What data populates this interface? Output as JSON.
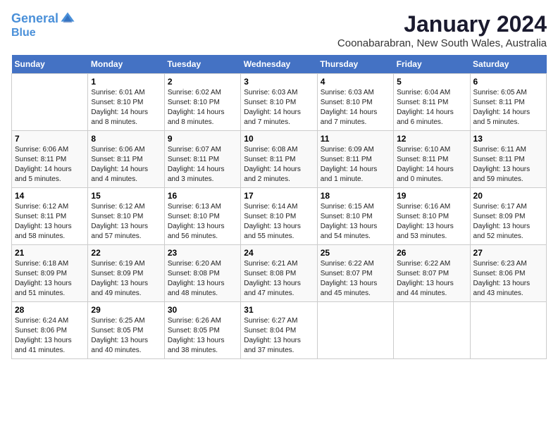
{
  "logo": {
    "line1": "General",
    "line2": "Blue"
  },
  "title": "January 2024",
  "subtitle": "Coonabarabran, New South Wales, Australia",
  "days_of_week": [
    "Sunday",
    "Monday",
    "Tuesday",
    "Wednesday",
    "Thursday",
    "Friday",
    "Saturday"
  ],
  "weeks": [
    [
      {
        "num": "",
        "sunrise": "",
        "sunset": "",
        "daylight": ""
      },
      {
        "num": "1",
        "sunrise": "Sunrise: 6:01 AM",
        "sunset": "Sunset: 8:10 PM",
        "daylight": "Daylight: 14 hours and 8 minutes."
      },
      {
        "num": "2",
        "sunrise": "Sunrise: 6:02 AM",
        "sunset": "Sunset: 8:10 PM",
        "daylight": "Daylight: 14 hours and 8 minutes."
      },
      {
        "num": "3",
        "sunrise": "Sunrise: 6:03 AM",
        "sunset": "Sunset: 8:10 PM",
        "daylight": "Daylight: 14 hours and 7 minutes."
      },
      {
        "num": "4",
        "sunrise": "Sunrise: 6:03 AM",
        "sunset": "Sunset: 8:10 PM",
        "daylight": "Daylight: 14 hours and 7 minutes."
      },
      {
        "num": "5",
        "sunrise": "Sunrise: 6:04 AM",
        "sunset": "Sunset: 8:11 PM",
        "daylight": "Daylight: 14 hours and 6 minutes."
      },
      {
        "num": "6",
        "sunrise": "Sunrise: 6:05 AM",
        "sunset": "Sunset: 8:11 PM",
        "daylight": "Daylight: 14 hours and 5 minutes."
      }
    ],
    [
      {
        "num": "7",
        "sunrise": "Sunrise: 6:06 AM",
        "sunset": "Sunset: 8:11 PM",
        "daylight": "Daylight: 14 hours and 5 minutes."
      },
      {
        "num": "8",
        "sunrise": "Sunrise: 6:06 AM",
        "sunset": "Sunset: 8:11 PM",
        "daylight": "Daylight: 14 hours and 4 minutes."
      },
      {
        "num": "9",
        "sunrise": "Sunrise: 6:07 AM",
        "sunset": "Sunset: 8:11 PM",
        "daylight": "Daylight: 14 hours and 3 minutes."
      },
      {
        "num": "10",
        "sunrise": "Sunrise: 6:08 AM",
        "sunset": "Sunset: 8:11 PM",
        "daylight": "Daylight: 14 hours and 2 minutes."
      },
      {
        "num": "11",
        "sunrise": "Sunrise: 6:09 AM",
        "sunset": "Sunset: 8:11 PM",
        "daylight": "Daylight: 14 hours and 1 minute."
      },
      {
        "num": "12",
        "sunrise": "Sunrise: 6:10 AM",
        "sunset": "Sunset: 8:11 PM",
        "daylight": "Daylight: 14 hours and 0 minutes."
      },
      {
        "num": "13",
        "sunrise": "Sunrise: 6:11 AM",
        "sunset": "Sunset: 8:11 PM",
        "daylight": "Daylight: 13 hours and 59 minutes."
      }
    ],
    [
      {
        "num": "14",
        "sunrise": "Sunrise: 6:12 AM",
        "sunset": "Sunset: 8:11 PM",
        "daylight": "Daylight: 13 hours and 58 minutes."
      },
      {
        "num": "15",
        "sunrise": "Sunrise: 6:12 AM",
        "sunset": "Sunset: 8:10 PM",
        "daylight": "Daylight: 13 hours and 57 minutes."
      },
      {
        "num": "16",
        "sunrise": "Sunrise: 6:13 AM",
        "sunset": "Sunset: 8:10 PM",
        "daylight": "Daylight: 13 hours and 56 minutes."
      },
      {
        "num": "17",
        "sunrise": "Sunrise: 6:14 AM",
        "sunset": "Sunset: 8:10 PM",
        "daylight": "Daylight: 13 hours and 55 minutes."
      },
      {
        "num": "18",
        "sunrise": "Sunrise: 6:15 AM",
        "sunset": "Sunset: 8:10 PM",
        "daylight": "Daylight: 13 hours and 54 minutes."
      },
      {
        "num": "19",
        "sunrise": "Sunrise: 6:16 AM",
        "sunset": "Sunset: 8:10 PM",
        "daylight": "Daylight: 13 hours and 53 minutes."
      },
      {
        "num": "20",
        "sunrise": "Sunrise: 6:17 AM",
        "sunset": "Sunset: 8:09 PM",
        "daylight": "Daylight: 13 hours and 52 minutes."
      }
    ],
    [
      {
        "num": "21",
        "sunrise": "Sunrise: 6:18 AM",
        "sunset": "Sunset: 8:09 PM",
        "daylight": "Daylight: 13 hours and 51 minutes."
      },
      {
        "num": "22",
        "sunrise": "Sunrise: 6:19 AM",
        "sunset": "Sunset: 8:09 PM",
        "daylight": "Daylight: 13 hours and 49 minutes."
      },
      {
        "num": "23",
        "sunrise": "Sunrise: 6:20 AM",
        "sunset": "Sunset: 8:08 PM",
        "daylight": "Daylight: 13 hours and 48 minutes."
      },
      {
        "num": "24",
        "sunrise": "Sunrise: 6:21 AM",
        "sunset": "Sunset: 8:08 PM",
        "daylight": "Daylight: 13 hours and 47 minutes."
      },
      {
        "num": "25",
        "sunrise": "Sunrise: 6:22 AM",
        "sunset": "Sunset: 8:07 PM",
        "daylight": "Daylight: 13 hours and 45 minutes."
      },
      {
        "num": "26",
        "sunrise": "Sunrise: 6:22 AM",
        "sunset": "Sunset: 8:07 PM",
        "daylight": "Daylight: 13 hours and 44 minutes."
      },
      {
        "num": "27",
        "sunrise": "Sunrise: 6:23 AM",
        "sunset": "Sunset: 8:06 PM",
        "daylight": "Daylight: 13 hours and 43 minutes."
      }
    ],
    [
      {
        "num": "28",
        "sunrise": "Sunrise: 6:24 AM",
        "sunset": "Sunset: 8:06 PM",
        "daylight": "Daylight: 13 hours and 41 minutes."
      },
      {
        "num": "29",
        "sunrise": "Sunrise: 6:25 AM",
        "sunset": "Sunset: 8:05 PM",
        "daylight": "Daylight: 13 hours and 40 minutes."
      },
      {
        "num": "30",
        "sunrise": "Sunrise: 6:26 AM",
        "sunset": "Sunset: 8:05 PM",
        "daylight": "Daylight: 13 hours and 38 minutes."
      },
      {
        "num": "31",
        "sunrise": "Sunrise: 6:27 AM",
        "sunset": "Sunset: 8:04 PM",
        "daylight": "Daylight: 13 hours and 37 minutes."
      },
      {
        "num": "",
        "sunrise": "",
        "sunset": "",
        "daylight": ""
      },
      {
        "num": "",
        "sunrise": "",
        "sunset": "",
        "daylight": ""
      },
      {
        "num": "",
        "sunrise": "",
        "sunset": "",
        "daylight": ""
      }
    ]
  ]
}
